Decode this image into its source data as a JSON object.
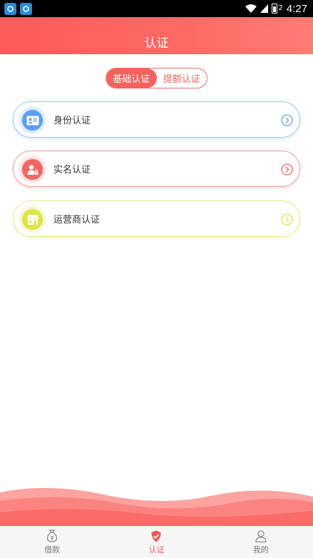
{
  "status_bar": {
    "time": "4:27",
    "battery_level": "2"
  },
  "header": {
    "title": "认证"
  },
  "segment": {
    "active_label": "基础认证",
    "inactive_label": "提额认证"
  },
  "cards": [
    {
      "label": "身份认证",
      "icon": "id-card-icon",
      "color": "#5d9ff0"
    },
    {
      "label": "实名认证",
      "icon": "user-lock-icon",
      "color": "#f36563"
    },
    {
      "label": "运营商认证",
      "icon": "store-icon",
      "color": "#dde445"
    }
  ],
  "tabs": [
    {
      "label": "借款",
      "icon": "money-bag-icon",
      "active": false
    },
    {
      "label": "认证",
      "icon": "shield-check-icon",
      "active": true
    },
    {
      "label": "我的",
      "icon": "person-icon",
      "active": false
    }
  ],
  "colors": {
    "primary": "#f4615e",
    "wave": "#fc6f6b"
  }
}
